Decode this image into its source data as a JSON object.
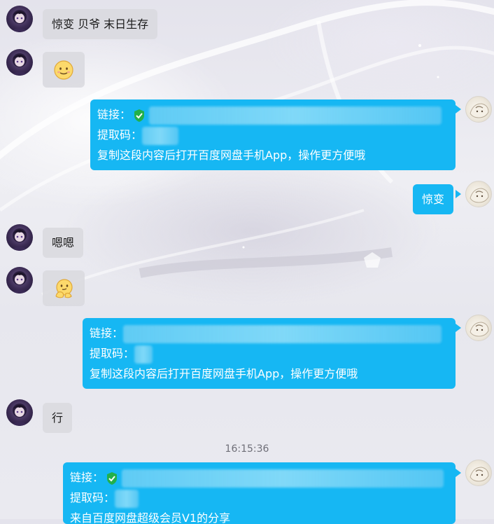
{
  "colors": {
    "sent_bubble": "#16b7f3",
    "recv_bubble": "#dadae0",
    "link_check": "#22b04b"
  },
  "messages": [
    {
      "side": "left",
      "avatar": "avatar-dark",
      "text": "惊变   贝爷  末日生存"
    },
    {
      "side": "left",
      "avatar": "avatar-dark",
      "emoji": "smiling-face-icon"
    },
    {
      "side": "right",
      "avatar": "avatar-light",
      "link_label": "链接：",
      "code_label": "提取码：",
      "footer": "复制这段内容后打开百度网盘手机App，操作更方便哦"
    },
    {
      "side": "right",
      "avatar": "avatar-light",
      "text": "惊变"
    },
    {
      "side": "left",
      "avatar": "avatar-dark",
      "text": "嗯嗯"
    },
    {
      "side": "left",
      "avatar": "avatar-dark",
      "emoji": "thinking-face-icon"
    },
    {
      "side": "right",
      "avatar": "avatar-light",
      "link_label": "链接：",
      "code_label": "提取码：",
      "footer": "复制这段内容后打开百度网盘手机App，操作更方便哦"
    },
    {
      "side": "left",
      "avatar": "avatar-dark",
      "text": "行"
    },
    {
      "side": "right",
      "avatar": "avatar-light",
      "link_label": "链接：",
      "code_label": "提取码：",
      "footer": "来自百度网盘超级会员V1的分享"
    }
  ],
  "timestamp": "16:15:36"
}
